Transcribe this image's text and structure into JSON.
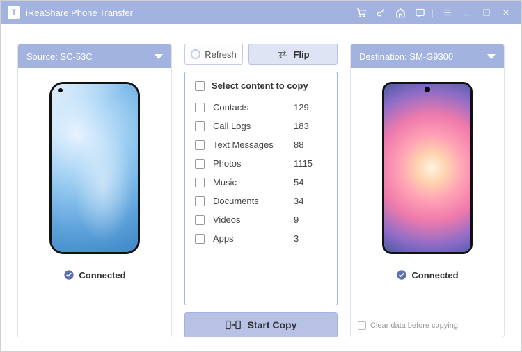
{
  "title": "iReaShare Phone Transfer",
  "source": {
    "label": "Source:",
    "device": "SC-53C",
    "status": "Connected"
  },
  "dest": {
    "label": "Destination:",
    "device": "SM-G9300",
    "status": "Connected"
  },
  "buttons": {
    "refresh": "Refresh",
    "flip": "Flip",
    "start": "Start Copy"
  },
  "selectHeader": "Select content to copy",
  "items": [
    {
      "name": "Contacts",
      "count": "129"
    },
    {
      "name": "Call Logs",
      "count": "183"
    },
    {
      "name": "Text Messages",
      "count": "88"
    },
    {
      "name": "Photos",
      "count": "1115"
    },
    {
      "name": "Music",
      "count": "54"
    },
    {
      "name": "Documents",
      "count": "34"
    },
    {
      "name": "Videos",
      "count": "9"
    },
    {
      "name": "Apps",
      "count": "3"
    }
  ],
  "clearData": "Clear data before copying"
}
